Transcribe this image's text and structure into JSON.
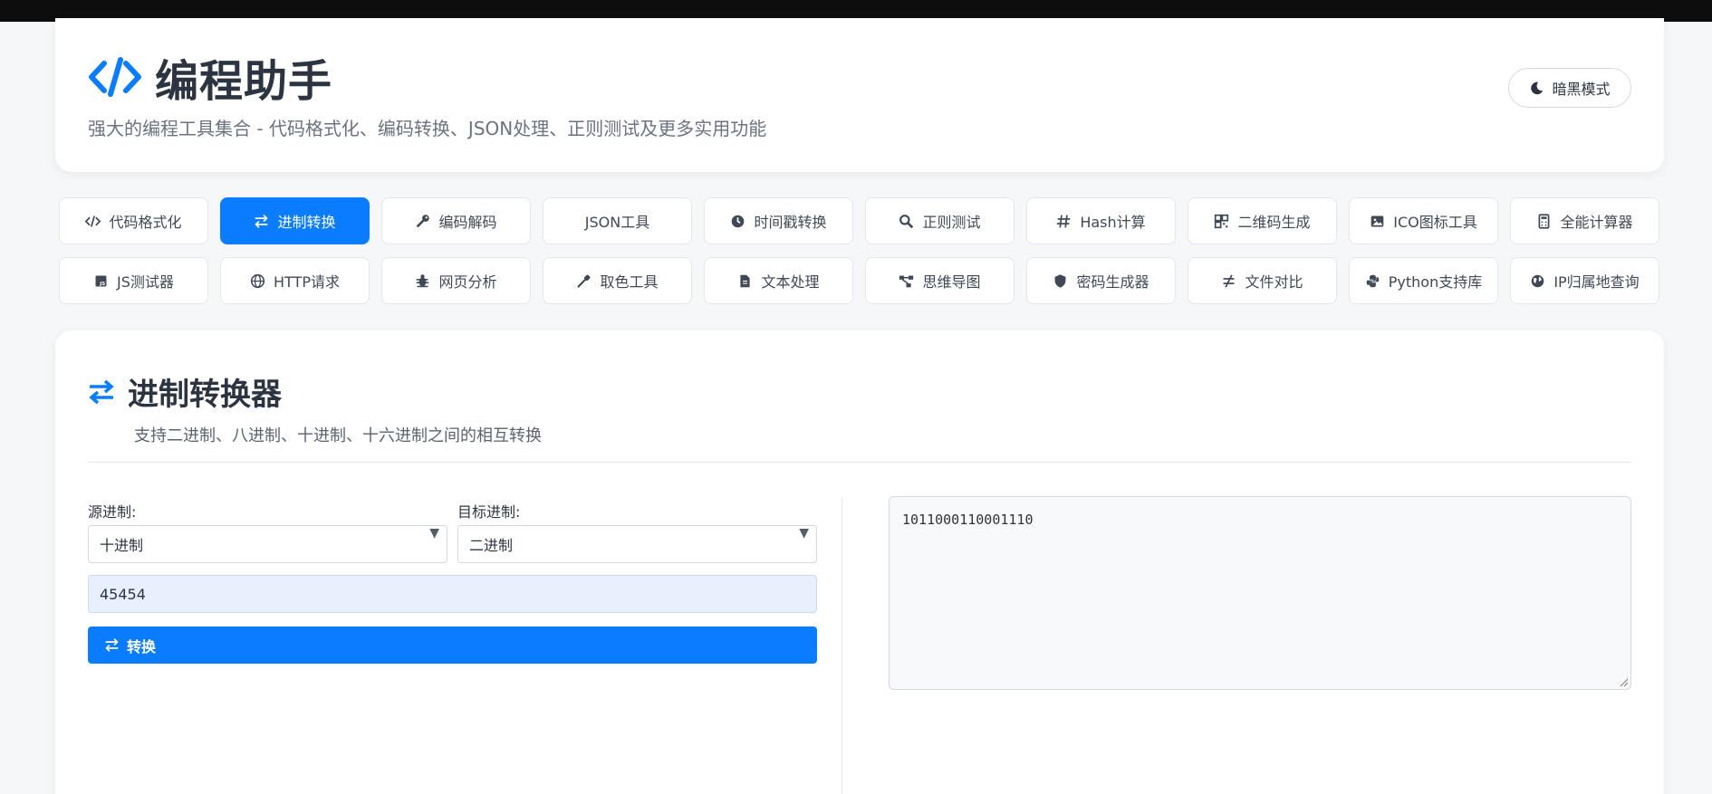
{
  "app": {
    "title": "编程助手",
    "subtitle": "强大的编程工具集合 - 代码格式化、编码转换、JSON处理、正则测试及更多实用功能",
    "dark_mode_label": "暗黑模式"
  },
  "tabs": [
    {
      "label": "代码格式化",
      "icon": "code-icon"
    },
    {
      "label": "进制转换",
      "icon": "exchange-icon",
      "active": true
    },
    {
      "label": "编码解码",
      "icon": "key-icon"
    },
    {
      "label": "JSON工具",
      "icon": "none"
    },
    {
      "label": "时间戳转换",
      "icon": "clock-icon"
    },
    {
      "label": "正则测试",
      "icon": "search-icon"
    },
    {
      "label": "Hash计算",
      "icon": "hash-icon"
    },
    {
      "label": "二维码生成",
      "icon": "qrcode-icon"
    },
    {
      "label": "ICO图标工具",
      "icon": "image-icon"
    },
    {
      "label": "全能计算器",
      "icon": "calculator-icon"
    },
    {
      "label": "JS测试器",
      "icon": "js-icon"
    },
    {
      "label": "HTTP请求",
      "icon": "globe-icon"
    },
    {
      "label": "网页分析",
      "icon": "bug-icon"
    },
    {
      "label": "取色工具",
      "icon": "eyedropper-icon"
    },
    {
      "label": "文本处理",
      "icon": "file-icon"
    },
    {
      "label": "思维导图",
      "icon": "sitemap-icon"
    },
    {
      "label": "密码生成器",
      "icon": "shield-icon"
    },
    {
      "label": "文件对比",
      "icon": "not-equal-icon"
    },
    {
      "label": "Python支持库",
      "icon": "python-icon"
    },
    {
      "label": "IP归属地查询",
      "icon": "globe-solid-icon"
    }
  ],
  "converter": {
    "title": "进制转换器",
    "description": "支持二进制、八进制、十进制、十六进制之间的相互转换",
    "source_label": "源进制:",
    "source_value": "十进制",
    "target_label": "目标进制:",
    "target_value": "二进制",
    "input_value": "45454",
    "convert_label": "转换",
    "output_value": "1011000110001110"
  },
  "colors": {
    "accent": "#0a7cff",
    "topbar": "#0d0d0d",
    "text": "#2b3440"
  }
}
